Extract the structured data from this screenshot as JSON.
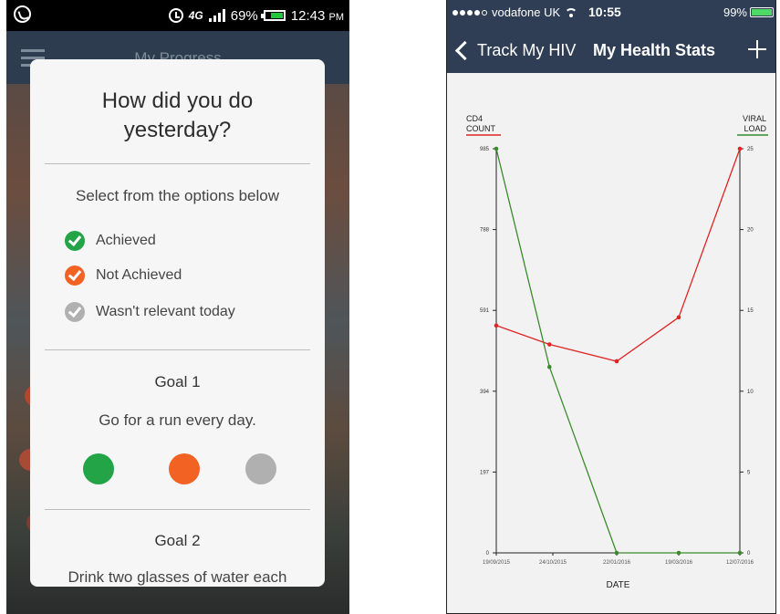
{
  "left_screen": {
    "status": {
      "battery": "69%",
      "time": "12:43",
      "ampm": "PM",
      "network": "4G"
    },
    "app_title": "My Progress",
    "dialog": {
      "title_line1": "How did you do",
      "title_line2": "yesterday?",
      "subtitle": "Select from the options below",
      "options": [
        {
          "label": "Achieved",
          "color": "#22a447"
        },
        {
          "label": "Not Achieved",
          "color": "#f26222"
        },
        {
          "label": "Wasn't relevant today",
          "color": "#b0b0b0"
        }
      ],
      "goal1": {
        "heading": "Goal 1",
        "text": "Go for a run every day."
      },
      "goal2": {
        "heading": "Goal 2",
        "text": "Drink two glasses of water each"
      }
    }
  },
  "right_screen": {
    "status": {
      "carrier": "vodafone UK",
      "time": "10:55",
      "battery": "99%"
    },
    "nav": {
      "back_label": "Track My HIV",
      "title": "My Health Stats"
    },
    "chart_data": {
      "type": "line",
      "x": [
        "19/09/2015",
        "24/10/2015",
        "22/01/2016",
        "19/03/2016",
        "12/07/2016"
      ],
      "xlabel": "DATE",
      "left_axis": {
        "label_line1": "CD4",
        "label_line2": "COUNT",
        "ticks": [
          "985",
          "788",
          "591",
          "394",
          "197",
          "0"
        ],
        "ylim": [
          0,
          985
        ],
        "color": "#e02424"
      },
      "right_axis": {
        "label_line1": "VIRAL",
        "label_line2": "LOAD",
        "ticks": [
          "25",
          "20",
          "15",
          "10",
          "5",
          "0"
        ],
        "ylim": [
          0,
          25
        ],
        "color": "#2e8b2e"
      },
      "series": [
        {
          "axis": "left",
          "color": "#e02424",
          "points": [
            {
              "x": 0,
              "y": 554
            },
            {
              "x": 0.94,
              "y": 508
            },
            {
              "x": 2,
              "y": 467
            },
            {
              "x": 3,
              "y": 574
            },
            {
              "x": 4,
              "y": 985
            }
          ]
        },
        {
          "axis": "right",
          "color": "#3c8a2e",
          "points": [
            {
              "x": 0,
              "y": 25
            },
            {
              "x": 0.94,
              "y": 11.5
            },
            {
              "x": 2,
              "y": 0
            },
            {
              "x": 3,
              "y": 0
            },
            {
              "x": 4,
              "y": 0
            }
          ]
        }
      ]
    }
  }
}
